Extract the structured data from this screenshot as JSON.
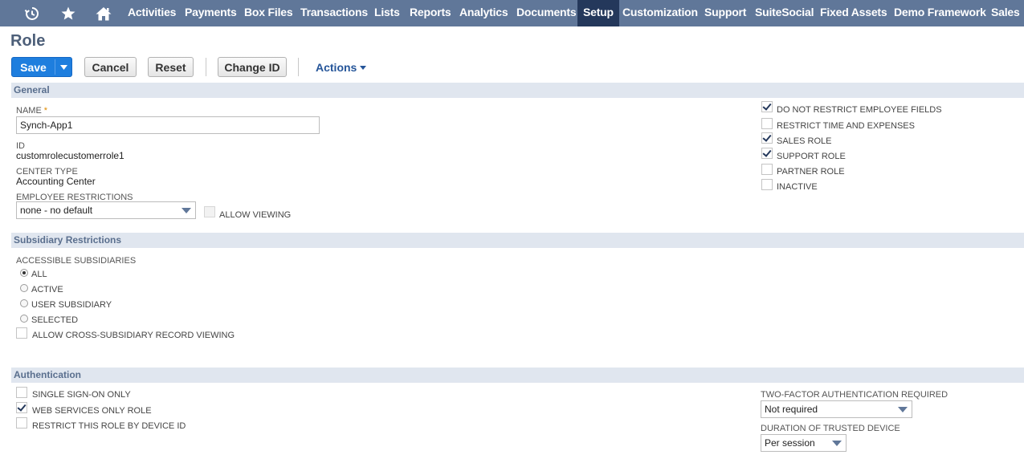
{
  "nav": {
    "icons": [
      "recent-history-icon",
      "star-icon",
      "home-icon"
    ],
    "items": [
      "Activities",
      "Payments",
      "Box Files",
      "Transactions",
      "Lists",
      "Reports",
      "Analytics",
      "Documents",
      "Setup",
      "Customization",
      "Support",
      "SuiteSocial",
      "Fixed Assets",
      "Demo Framework",
      "Sales"
    ],
    "active": "Setup"
  },
  "page": {
    "title": "Role"
  },
  "toolbar": {
    "save_label": "Save",
    "cancel_label": "Cancel",
    "reset_label": "Reset",
    "change_id_label": "Change ID",
    "actions_label": "Actions"
  },
  "general": {
    "header": "General",
    "name_label": "NAME",
    "name_required_mark": "*",
    "name_value": "Synch-App1",
    "id_label": "ID",
    "id_value": "customrolecustomerrole1",
    "center_type_label": "CENTER TYPE",
    "center_type_value": "Accounting Center",
    "employee_restrictions_label": "EMPLOYEE RESTRICTIONS",
    "employee_restrictions_value": "none - no default",
    "allow_viewing_label": "ALLOW VIEWING",
    "allow_viewing_checked": false,
    "flags": [
      {
        "label": "DO NOT RESTRICT EMPLOYEE FIELDS",
        "checked": true
      },
      {
        "label": "RESTRICT TIME AND EXPENSES",
        "checked": false
      },
      {
        "label": "SALES ROLE",
        "checked": true
      },
      {
        "label": "SUPPORT ROLE",
        "checked": true
      },
      {
        "label": "PARTNER ROLE",
        "checked": false
      },
      {
        "label": "INACTIVE",
        "checked": false
      }
    ]
  },
  "subsidiary": {
    "header": "Subsidiary Restrictions",
    "accessible_label": "ACCESSIBLE SUBSIDIARIES",
    "options": [
      {
        "label": "ALL",
        "selected": true
      },
      {
        "label": "ACTIVE",
        "selected": false
      },
      {
        "label": "USER SUBSIDIARY",
        "selected": false
      },
      {
        "label": "SELECTED",
        "selected": false
      }
    ],
    "cross_sub_label": "ALLOW CROSS-SUBSIDIARY RECORD VIEWING",
    "cross_sub_checked": false
  },
  "authentication": {
    "header": "Authentication",
    "options": [
      {
        "label": "SINGLE SIGN-ON ONLY",
        "checked": false
      },
      {
        "label": "WEB SERVICES ONLY ROLE",
        "checked": true
      },
      {
        "label": "RESTRICT THIS ROLE BY DEVICE ID",
        "checked": false
      }
    ],
    "two_factor_label": "TWO-FACTOR AUTHENTICATION REQUIRED",
    "two_factor_value": "Not required",
    "duration_label": "DURATION OF TRUSTED DEVICE",
    "duration_value": "Per session"
  },
  "colors": {
    "nav_bg": "#607799",
    "nav_active_bg": "#24385b",
    "save_button": "#1e7ede",
    "section_bg": "#e0e6ef",
    "title": "#4d5f79",
    "required_mark": "#e08a00"
  }
}
